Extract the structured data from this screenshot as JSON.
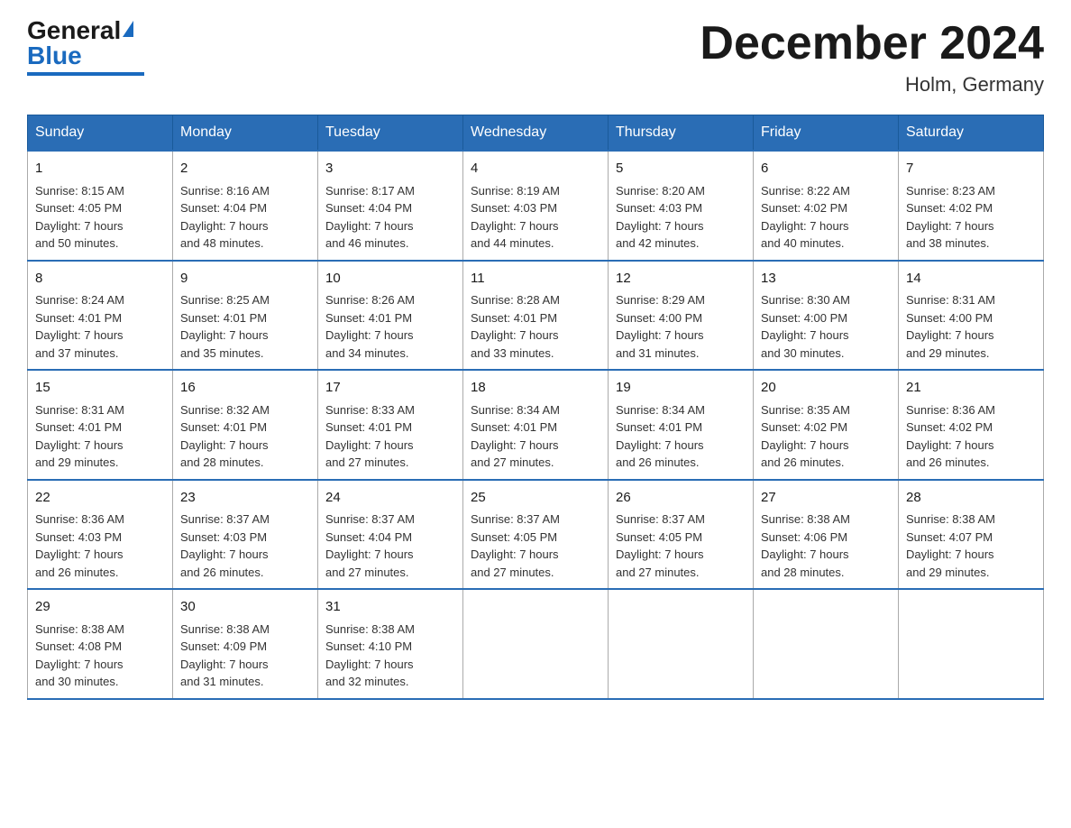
{
  "logo": {
    "general": "General",
    "blue": "Blue"
  },
  "header": {
    "month_year": "December 2024",
    "location": "Holm, Germany"
  },
  "weekdays": [
    "Sunday",
    "Monday",
    "Tuesday",
    "Wednesday",
    "Thursday",
    "Friday",
    "Saturday"
  ],
  "weeks": [
    [
      {
        "day": "1",
        "sunrise": "8:15 AM",
        "sunset": "4:05 PM",
        "daylight": "7 hours and 50 minutes."
      },
      {
        "day": "2",
        "sunrise": "8:16 AM",
        "sunset": "4:04 PM",
        "daylight": "7 hours and 48 minutes."
      },
      {
        "day": "3",
        "sunrise": "8:17 AM",
        "sunset": "4:04 PM",
        "daylight": "7 hours and 46 minutes."
      },
      {
        "day": "4",
        "sunrise": "8:19 AM",
        "sunset": "4:03 PM",
        "daylight": "7 hours and 44 minutes."
      },
      {
        "day": "5",
        "sunrise": "8:20 AM",
        "sunset": "4:03 PM",
        "daylight": "7 hours and 42 minutes."
      },
      {
        "day": "6",
        "sunrise": "8:22 AM",
        "sunset": "4:02 PM",
        "daylight": "7 hours and 40 minutes."
      },
      {
        "day": "7",
        "sunrise": "8:23 AM",
        "sunset": "4:02 PM",
        "daylight": "7 hours and 38 minutes."
      }
    ],
    [
      {
        "day": "8",
        "sunrise": "8:24 AM",
        "sunset": "4:01 PM",
        "daylight": "7 hours and 37 minutes."
      },
      {
        "day": "9",
        "sunrise": "8:25 AM",
        "sunset": "4:01 PM",
        "daylight": "7 hours and 35 minutes."
      },
      {
        "day": "10",
        "sunrise": "8:26 AM",
        "sunset": "4:01 PM",
        "daylight": "7 hours and 34 minutes."
      },
      {
        "day": "11",
        "sunrise": "8:28 AM",
        "sunset": "4:01 PM",
        "daylight": "7 hours and 33 minutes."
      },
      {
        "day": "12",
        "sunrise": "8:29 AM",
        "sunset": "4:00 PM",
        "daylight": "7 hours and 31 minutes."
      },
      {
        "day": "13",
        "sunrise": "8:30 AM",
        "sunset": "4:00 PM",
        "daylight": "7 hours and 30 minutes."
      },
      {
        "day": "14",
        "sunrise": "8:31 AM",
        "sunset": "4:00 PM",
        "daylight": "7 hours and 29 minutes."
      }
    ],
    [
      {
        "day": "15",
        "sunrise": "8:31 AM",
        "sunset": "4:01 PM",
        "daylight": "7 hours and 29 minutes."
      },
      {
        "day": "16",
        "sunrise": "8:32 AM",
        "sunset": "4:01 PM",
        "daylight": "7 hours and 28 minutes."
      },
      {
        "day": "17",
        "sunrise": "8:33 AM",
        "sunset": "4:01 PM",
        "daylight": "7 hours and 27 minutes."
      },
      {
        "day": "18",
        "sunrise": "8:34 AM",
        "sunset": "4:01 PM",
        "daylight": "7 hours and 27 minutes."
      },
      {
        "day": "19",
        "sunrise": "8:34 AM",
        "sunset": "4:01 PM",
        "daylight": "7 hours and 26 minutes."
      },
      {
        "day": "20",
        "sunrise": "8:35 AM",
        "sunset": "4:02 PM",
        "daylight": "7 hours and 26 minutes."
      },
      {
        "day": "21",
        "sunrise": "8:36 AM",
        "sunset": "4:02 PM",
        "daylight": "7 hours and 26 minutes."
      }
    ],
    [
      {
        "day": "22",
        "sunrise": "8:36 AM",
        "sunset": "4:03 PM",
        "daylight": "7 hours and 26 minutes."
      },
      {
        "day": "23",
        "sunrise": "8:37 AM",
        "sunset": "4:03 PM",
        "daylight": "7 hours and 26 minutes."
      },
      {
        "day": "24",
        "sunrise": "8:37 AM",
        "sunset": "4:04 PM",
        "daylight": "7 hours and 27 minutes."
      },
      {
        "day": "25",
        "sunrise": "8:37 AM",
        "sunset": "4:05 PM",
        "daylight": "7 hours and 27 minutes."
      },
      {
        "day": "26",
        "sunrise": "8:37 AM",
        "sunset": "4:05 PM",
        "daylight": "7 hours and 27 minutes."
      },
      {
        "day": "27",
        "sunrise": "8:38 AM",
        "sunset": "4:06 PM",
        "daylight": "7 hours and 28 minutes."
      },
      {
        "day": "28",
        "sunrise": "8:38 AM",
        "sunset": "4:07 PM",
        "daylight": "7 hours and 29 minutes."
      }
    ],
    [
      {
        "day": "29",
        "sunrise": "8:38 AM",
        "sunset": "4:08 PM",
        "daylight": "7 hours and 30 minutes."
      },
      {
        "day": "30",
        "sunrise": "8:38 AM",
        "sunset": "4:09 PM",
        "daylight": "7 hours and 31 minutes."
      },
      {
        "day": "31",
        "sunrise": "8:38 AM",
        "sunset": "4:10 PM",
        "daylight": "7 hours and 32 minutes."
      },
      null,
      null,
      null,
      null
    ]
  ],
  "labels": {
    "sunrise": "Sunrise:",
    "sunset": "Sunset:",
    "daylight": "Daylight:"
  }
}
